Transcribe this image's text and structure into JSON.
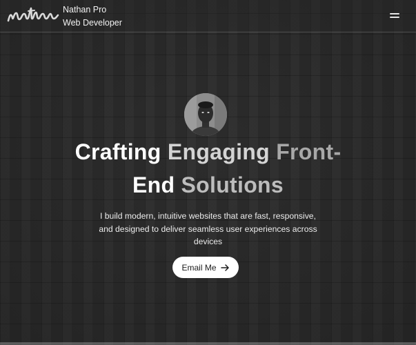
{
  "header": {
    "logo_text": "nathan",
    "brand_name": "Nathan Pro",
    "brand_role": "Web Developer",
    "menu_icon": "hamburger-menu-icon"
  },
  "hero": {
    "avatar": "profile-photo",
    "headline": {
      "word1": "Crafting",
      "word2": "Engaging",
      "word3": "Front-",
      "word4": "End",
      "word5": "Solutions"
    },
    "subtitle": "I build modern, intuitive websites that are fast, responsive, and designed to deliver seamless user experiences across devices",
    "cta_label": "Email Me",
    "cta_icon": "arrow-right-icon"
  },
  "colors": {
    "background": "#2c2c2c",
    "text": "#ffffff",
    "button_bg": "#ffffff",
    "button_text": "#1b1b1b"
  }
}
